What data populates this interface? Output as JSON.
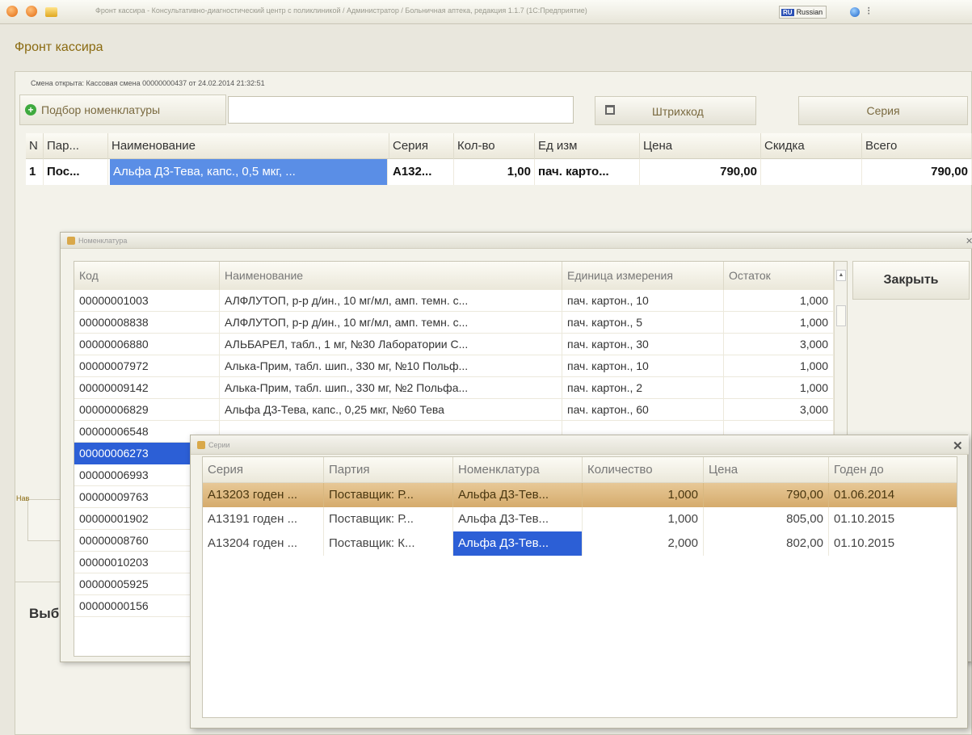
{
  "titlebar": {
    "text": "Фронт кассира - Консультативно-диагностический центр с поликлиникой / Администратор / Больничная аптека, редакция 1.1.7 (1С:Предприятие)",
    "lang_code": "RU",
    "lang_name": "Russian"
  },
  "main": {
    "title": "Фронт кассира",
    "shift_info": "Смена открыта: Кассовая смена 00000000437 от 24.02.2014 21:32:51",
    "pick_button": "Подбор номенклатуры",
    "search_value": "",
    "barcode_button": "Штрихкод",
    "series_button": "Серия",
    "side_label_1": "Нав",
    "side_label_2": "Выб",
    "grid": {
      "headers": [
        "N",
        "Пар...",
        "Наименование",
        "Серия",
        "Кол-во",
        "Ед изм",
        "Цена",
        "Скидка",
        "Всего"
      ],
      "rows": [
        [
          "1",
          "Пос...",
          "Альфа Д3-Тева, капс., 0,5 мкг, ...",
          "A132...",
          "1,00",
          "пач. карто...",
          "790,00",
          "",
          "790,00"
        ]
      ]
    }
  },
  "nom_window": {
    "title": "Номенклатура",
    "close_button": "Закрыть",
    "headers": [
      "Код",
      "Наименование",
      "Единица измерения",
      "Остаток"
    ],
    "rows": [
      [
        "00000001003",
        "АЛФЛУТОП, р-р д/ин., 10 мг/мл, амп. темн. с...",
        "пач. картон., 10",
        "1,000"
      ],
      [
        "00000008838",
        "АЛФЛУТОП, р-р д/ин., 10 мг/мл, амп. темн. с...",
        "пач. картон., 5",
        "1,000"
      ],
      [
        "00000006880",
        "АЛЬБАРЕЛ, табл., 1 мг, №30 Лаборатории С...",
        "пач. картон., 30",
        "3,000"
      ],
      [
        "00000007972",
        "Алька-Прим, табл. шип., 330 мг, №10 Польф...",
        "пач. картон., 10",
        "1,000"
      ],
      [
        "00000009142",
        "Алька-Прим, табл. шип., 330 мг, №2 Польфа...",
        "пач. картон., 2",
        "1,000"
      ],
      [
        "00000006829",
        "Альфа Д3-Тева, капс., 0,25 мкг, №60 Тева",
        "пач. картон., 60",
        "3,000"
      ],
      [
        "00000006548",
        "",
        "",
        ""
      ],
      [
        "00000006273",
        "",
        "",
        ""
      ],
      [
        "00000006993",
        "",
        "",
        ""
      ],
      [
        "00000009763",
        "",
        "",
        ""
      ],
      [
        "00000001902",
        "",
        "",
        ""
      ],
      [
        "00000008760",
        "",
        "",
        ""
      ],
      [
        "00000010203",
        "",
        "",
        ""
      ],
      [
        "00000005925",
        "",
        "",
        ""
      ],
      [
        "00000000156",
        "",
        "",
        ""
      ]
    ],
    "selected_code": "00000006273"
  },
  "series_window": {
    "title": "Серии",
    "headers": [
      "Серия",
      "Партия",
      "Номенклатура",
      "Количество",
      "Цена",
      "Годен до"
    ],
    "rows": [
      [
        "A13203 годен ...",
        "Поставщик: Р...",
        "Альфа Д3-Тев...",
        "1,000",
        "790,00",
        "01.06.2014"
      ],
      [
        "A13191 годен ...",
        "Поставщик: Р...",
        "Альфа Д3-Тев...",
        "1,000",
        "805,00",
        "01.10.2015"
      ],
      [
        "A13204 годен ...",
        "Поставщик: К...",
        "Альфа Д3-Тев...",
        "2,000",
        "802,00",
        "01.10.2015"
      ]
    ]
  },
  "colors": {
    "selection": "#2c5fd6",
    "current_row": "#ddb87c",
    "title_accent": "#8a6a10"
  }
}
